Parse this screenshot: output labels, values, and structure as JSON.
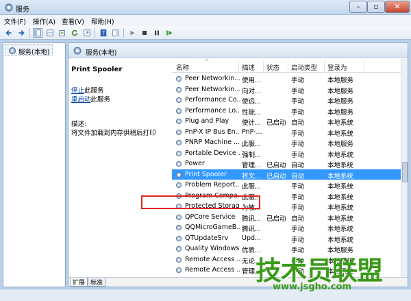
{
  "window": {
    "title": "服务"
  },
  "menu": {
    "items": [
      "文件(F)",
      "操作(A)",
      "查看(V)",
      "帮助(H)"
    ]
  },
  "tree": {
    "label": "服务(本地)"
  },
  "main_header": {
    "label": "服务(本地)"
  },
  "description": {
    "service_name": "Print Spooler",
    "stop_link": "停止",
    "stop_suffix": "此服务",
    "restart_link": "重启动",
    "restart_suffix": "此服务",
    "desc_label": "描述:",
    "desc_text": "将文件加载到内存供稍后打印"
  },
  "table": {
    "headers": [
      "名称",
      "描述",
      "状态",
      "启动类型",
      "登录为"
    ],
    "rows": [
      [
        "Peer Networkin...",
        "使用...",
        "",
        "手动",
        "本地服务"
      ],
      [
        "Peer Networkin...",
        "向对...",
        "",
        "手动",
        "本地服务"
      ],
      [
        "Performance Co...",
        "使远...",
        "",
        "手动",
        "本地服务"
      ],
      [
        "Performance Lo...",
        "性能...",
        "",
        "手动",
        "本地服务"
      ],
      [
        "Plug and Play",
        "使计...",
        "已启动",
        "自动",
        "本地系统"
      ],
      [
        "PnP-X IP Bus En...",
        "PnP-...",
        "",
        "手动",
        "本地系统"
      ],
      [
        "PNRP Machine ...",
        "此服...",
        "",
        "手动",
        "本地服务"
      ],
      [
        "Portable Device ...",
        "强制...",
        "",
        "手动",
        "本地系统"
      ],
      [
        "Power",
        "管理...",
        "已启动",
        "自动",
        "本地系统"
      ],
      [
        "Print Spooler",
        "将文...",
        "已启动",
        "自动",
        "本地系统"
      ],
      [
        "Problem Report...",
        "此服...",
        "",
        "手动",
        "本地系统"
      ],
      [
        "Program Compa...",
        "此服...",
        "",
        "手动",
        "本地系统"
      ],
      [
        "Protected Storage",
        "为敏...",
        "",
        "手动",
        "本地系统"
      ],
      [
        "QPCore Service",
        "腾讯...",
        "已启动",
        "自动",
        "本地系统"
      ],
      [
        "QQMicroGameB...",
        "腾讯...",
        "",
        "手动",
        "本地系统"
      ],
      [
        "QTUpdateSrv",
        "Upd...",
        "",
        "手动",
        "本地系统"
      ],
      [
        "Quality Windows...",
        "优质...",
        "",
        "手动",
        "本地服务"
      ],
      [
        "Remote Access ...",
        "无论...",
        "",
        "手动",
        "本地系统"
      ],
      [
        "Remote Access ...",
        "管理...",
        "",
        "手动",
        "本地系统"
      ]
    ],
    "selected_index": 9
  },
  "tabs": [
    "扩展",
    "标准"
  ],
  "watermark": {
    "main": "技术员联盟",
    "url": "www.jsgho.com"
  },
  "colors": {
    "selection": "#3399ff",
    "highlight_box": "#e0261f",
    "watermark": "#3a9b1a"
  }
}
